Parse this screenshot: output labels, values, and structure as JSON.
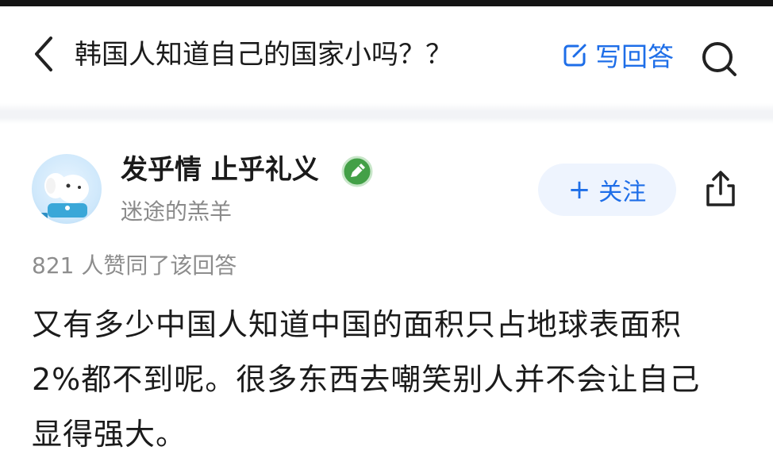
{
  "header": {
    "question_title": "韩国人知道自己的国家小吗？？",
    "write_answer_label": "写回答",
    "accent_color": "#1e6ee8"
  },
  "icons": {
    "back": "chevron-left-icon",
    "write": "edit-icon",
    "search": "search-icon",
    "badge": "pen-badge-icon",
    "share": "share-icon"
  },
  "author": {
    "name": "发乎情 止乎礼义",
    "subtitle": "迷途的羔羊",
    "follow_label": "关注",
    "follow_prefix": "+"
  },
  "answer": {
    "likes_text": "821 人赞同了该回答",
    "lines": [
      "又有多少中国人知道中国的面积只占地球表面积",
      "2%都不到呢。很多东西去嘲笑别人并不会让自己",
      "显得强大。"
    ]
  }
}
